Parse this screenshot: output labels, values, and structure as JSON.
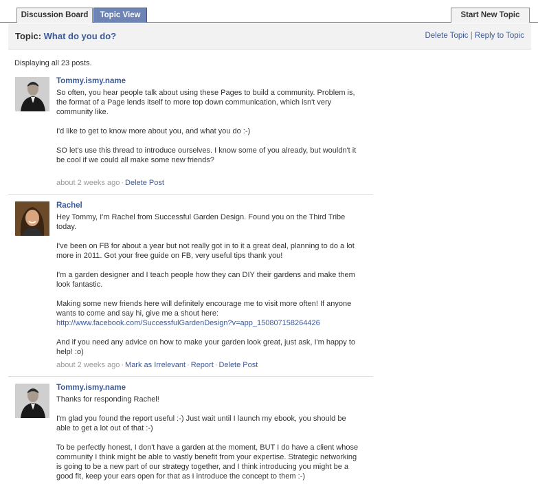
{
  "tabs": {
    "discussion_board": "Discussion Board",
    "topic_view": "Topic View",
    "start_new_topic": "Start New Topic"
  },
  "header": {
    "topic_label": "Topic:",
    "topic_title": "What do you do?",
    "delete_topic": "Delete Topic",
    "separator": "|",
    "reply_to_topic": "Reply to Topic"
  },
  "post_count": "Displaying all 23 posts.",
  "posts": [
    {
      "author": "Tommy.ismy.name",
      "avatar_icon": "profile-photo-man",
      "paragraphs": [
        "So often, you hear people talk about using these Pages to build a community. Problem is, the format of a Page lends itself to more top down communication, which isn't very community like.",
        "I'd like to get to know more about you, and what you do :-)",
        "SO let's use this thread to introduce ourselves. I know some of you already, but wouldn't it be cool if we could all make some new friends?"
      ],
      "time": "about 2 weeks ago",
      "actions": [
        "Delete Post"
      ]
    },
    {
      "author": "Rachel",
      "avatar_icon": "profile-photo-woman",
      "paragraphs": [
        "Hey Tommy, I'm Rachel from Successful Garden Design. Found you on the Third Tribe today.",
        "I've been on FB for about a year but not really got in to it a great deal, planning to do a lot more in 2011. Got your free guide on FB, very useful tips thank you!",
        "I'm a garden designer and I teach people how they can DIY their gardens and make them look fantastic.",
        "Making some new friends here will definitely encourage me to visit more often! If anyone wants to come and say hi, give me a shout here:",
        "And if you need any advice on how to make your garden look great, just ask, I'm happy to help! :o)"
      ],
      "link": "http://www.facebook.com/SuccessfulGardenDesign?v=app_150807158264426",
      "time": "about 2 weeks ago",
      "actions": [
        "Mark as Irrelevant",
        "Report",
        "Delete Post"
      ]
    },
    {
      "author": "Tommy.ismy.name",
      "avatar_icon": "profile-photo-man",
      "paragraphs": [
        "Thanks for responding Rachel!",
        "I'm glad you found the report useful :-) Just wait until I launch my ebook, you should be able to get a lot out of that :-)",
        "To be perfectly honest, I don't have a garden at the moment, BUT I do have a client whose community I think might be able to vastly benefit from your expertise. Strategic networking is going to be a new part of our strategy together, and I think introducing you might be a good fit, keep your ears open for that as I introduce the concept to them :-)"
      ]
    }
  ],
  "colors": {
    "link": "#3b5998",
    "active_tab": "#6d84b4",
    "header_bg": "#f2f2f2",
    "meta_text": "#999999"
  }
}
